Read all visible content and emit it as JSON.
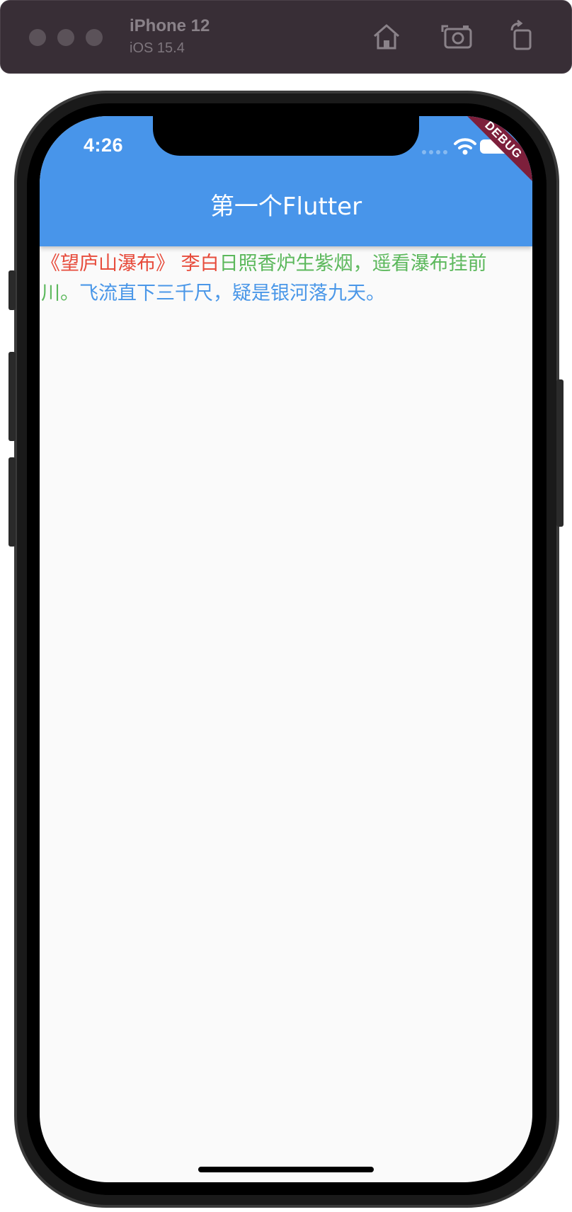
{
  "simulator": {
    "device_name": "iPhone 12",
    "os_version": "iOS 15.4",
    "tools": [
      "home-icon",
      "screenshot-icon",
      "rotate-icon"
    ]
  },
  "status_bar": {
    "time": "4:26",
    "icons": [
      "signal-icon",
      "wifi-icon",
      "battery-icon"
    ]
  },
  "debug_banner": "DEBUG",
  "app_bar": {
    "title": "第一个Flutter",
    "color": "#4895ea"
  },
  "poem": {
    "title": "《望庐山瀑布》",
    "author": " 李白",
    "line1": "日照香炉生紫烟，遥看瀑布挂前川。",
    "line2": "飞流直下三千尺，疑是银河落九天。",
    "colors": {
      "title": "#e74c3c",
      "author": "#e74c3c",
      "line1": "#5cb85c",
      "line2": "#4a97e8"
    }
  }
}
